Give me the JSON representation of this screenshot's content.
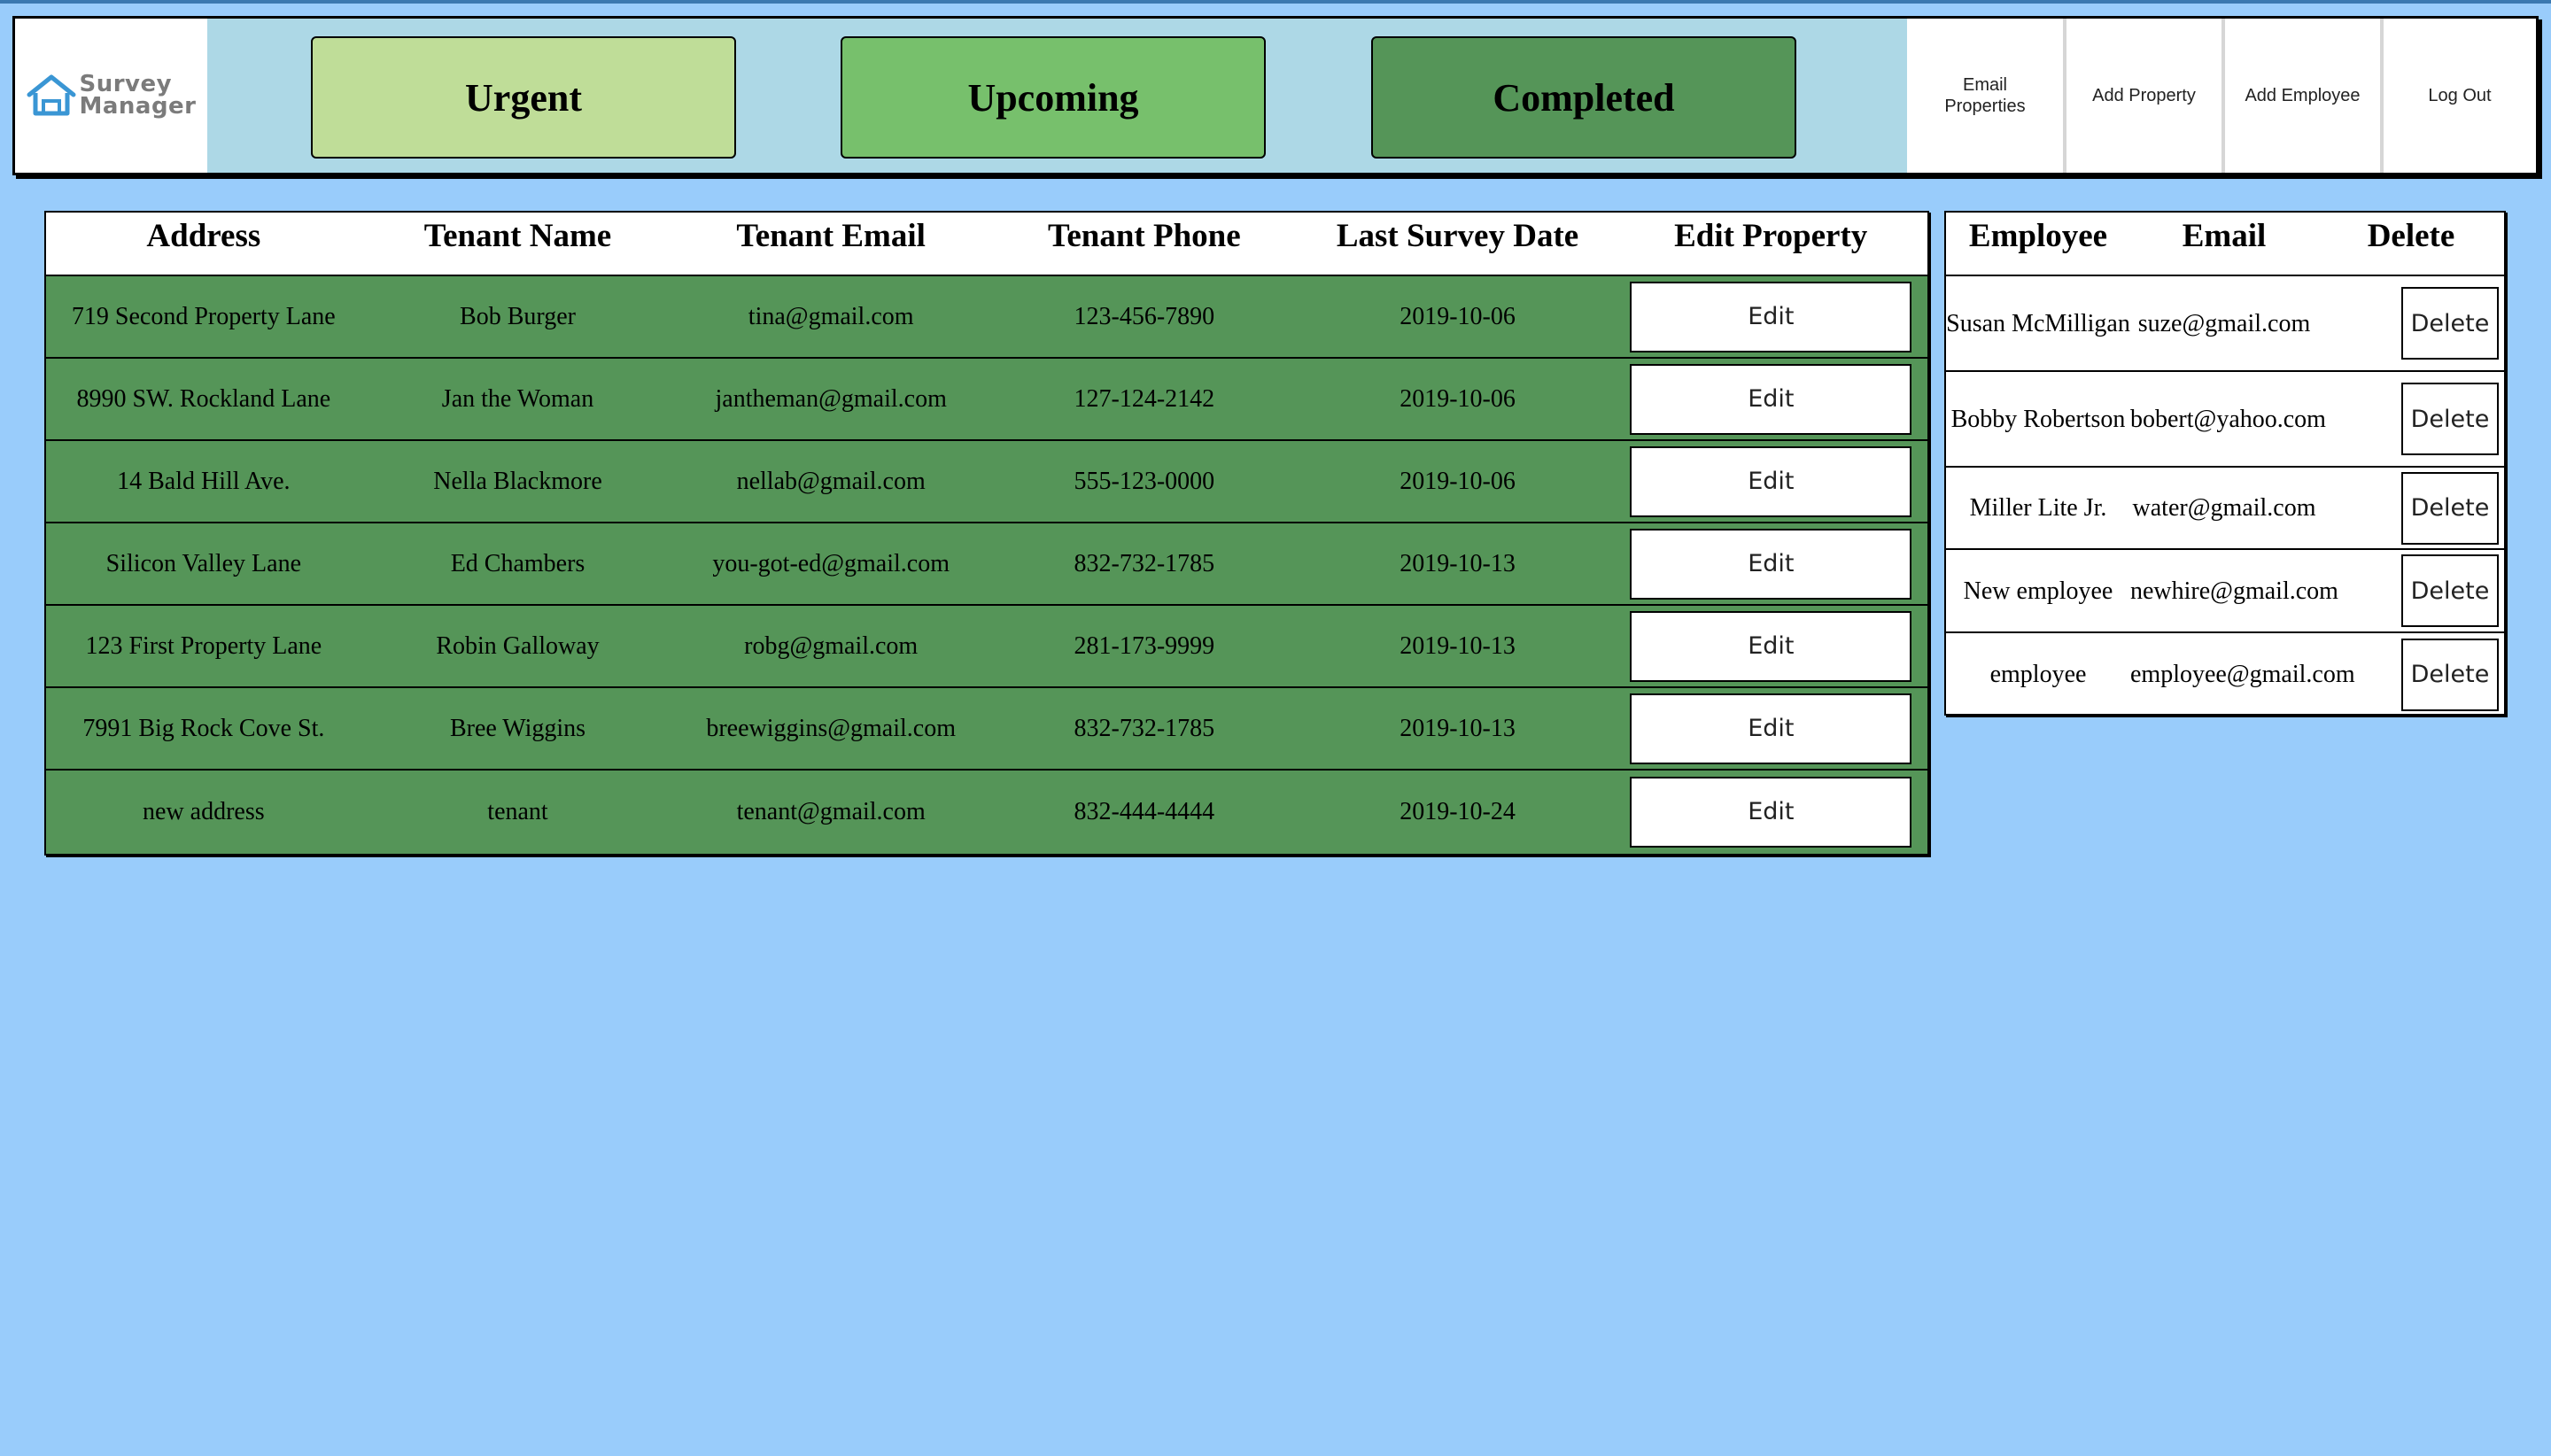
{
  "app": {
    "logo_line1": "Survey",
    "logo_line2": "Manager",
    "logo_icon": "house-icon"
  },
  "status_filters": [
    {
      "label": "Urgent",
      "color": "#bfdd98"
    },
    {
      "label": "Upcoming",
      "color": "#77c06c"
    },
    {
      "label": "Completed",
      "color": "#559558"
    }
  ],
  "nav": {
    "email_properties": "Email Properties",
    "add_property": "Add Property",
    "add_employee": "Add Employee",
    "log_out": "Log Out"
  },
  "properties": {
    "columns": [
      "Address",
      "Tenant Name",
      "Tenant Email",
      "Tenant Phone",
      "Last Survey Date",
      "Edit Property"
    ],
    "edit_label": "Edit",
    "rows": [
      {
        "address": "719 Second Property Lane",
        "tenant": "Bob Burger",
        "email": "tina@gmail.com",
        "phone": "123-456-7890",
        "date": "2019-10-06"
      },
      {
        "address": "8990 SW. Rockland Lane",
        "tenant": "Jan the Woman",
        "email": "jantheman@gmail.com",
        "phone": "127-124-2142",
        "date": "2019-10-06"
      },
      {
        "address": "14 Bald Hill Ave.",
        "tenant": "Nella Blackmore",
        "email": "nellab@gmail.com",
        "phone": "555-123-0000",
        "date": "2019-10-06"
      },
      {
        "address": "Silicon Valley Lane",
        "tenant": "Ed Chambers",
        "email": "you-got-ed@gmail.com",
        "phone": "832-732-1785",
        "date": "2019-10-13"
      },
      {
        "address": "123 First Property Lane",
        "tenant": "Robin Galloway",
        "email": "robg@gmail.com",
        "phone": "281-173-9999",
        "date": "2019-10-13"
      },
      {
        "address": "7991 Big Rock Cove St.",
        "tenant": "Bree Wiggins",
        "email": "breewiggins@gmail.com",
        "phone": "832-732-1785",
        "date": "2019-10-13"
      },
      {
        "address": "new address",
        "tenant": "tenant",
        "email": "tenant@gmail.com",
        "phone": "832-444-4444",
        "date": "2019-10-24"
      }
    ]
  },
  "employees": {
    "columns": [
      "Employee",
      "Email",
      "Delete"
    ],
    "delete_label": "Delete",
    "rows": [
      {
        "name": "Susan McMilligan",
        "email": "suze@gmail.com"
      },
      {
        "name": "Bobby Robertson",
        "email": "bobert@yahoo.com"
      },
      {
        "name": "Miller Lite Jr.",
        "email": "water@gmail.com"
      },
      {
        "name": "New employee",
        "email": "newhire@gmail.com"
      },
      {
        "name": "employee",
        "email": "employee@gmail.com"
      }
    ]
  }
}
